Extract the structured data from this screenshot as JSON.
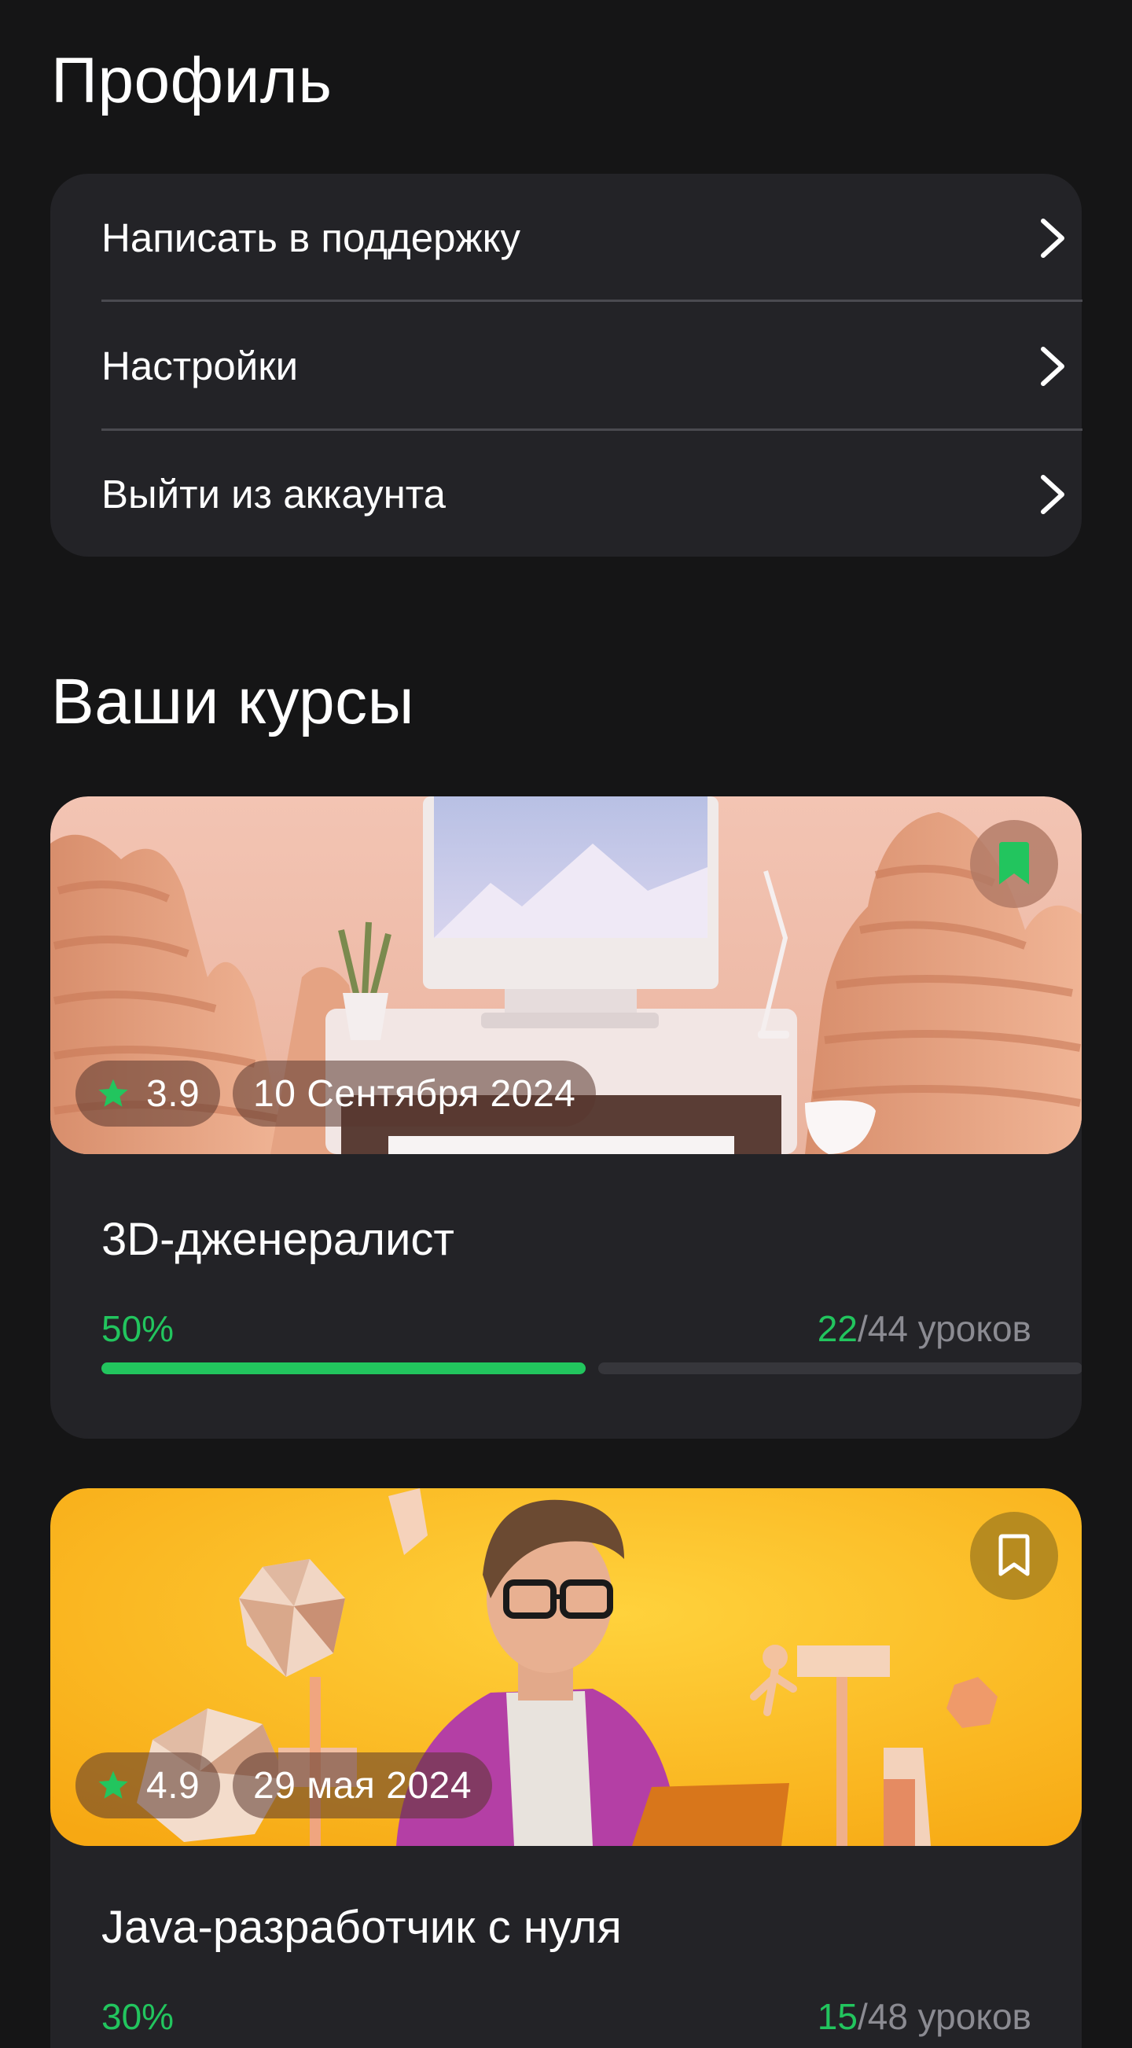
{
  "profile": {
    "title": "Профиль",
    "menu": [
      {
        "label": "Написать в поддержку"
      },
      {
        "label": "Настройки"
      },
      {
        "label": "Выйти из аккаунта"
      }
    ]
  },
  "courses_section": {
    "title": "Ваши курсы",
    "items": [
      {
        "title": "3D-дженералист",
        "rating": "3.9",
        "date": "10 Сентября 2024",
        "progress_text": "50%",
        "progress_fraction": 0.5,
        "lessons_done": "22",
        "lessons_rest": "/44 уроков",
        "bookmarked": true
      },
      {
        "title": "Java-разработчик с нуля",
        "rating": "4.9",
        "date": "29 мая 2024",
        "progress_text": "30%",
        "progress_fraction": 0.3,
        "lessons_done": "15",
        "lessons_rest": "/48 уроков",
        "bookmarked": false
      }
    ]
  },
  "colors": {
    "accent_green": "#22c55e",
    "background": "#151516",
    "card": "#232327"
  },
  "icons": [
    "chevron-right-icon",
    "star-icon",
    "bookmark-icon"
  ]
}
